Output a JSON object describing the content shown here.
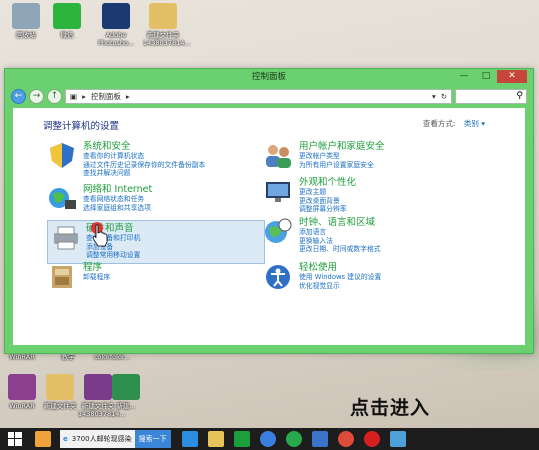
{
  "desktop": {
    "icons_top": [
      {
        "label": "回收站",
        "icon": "recycle-bin-icon",
        "color": "#8fa6b8"
      },
      {
        "label": "微信",
        "icon": "wechat-icon",
        "color": "#2db43c"
      },
      {
        "label": "Adobe Photosho...",
        "icon": "photoshop-icon",
        "color": "#1c3a72"
      },
      {
        "label": "新建文件夹 1438037814...",
        "icon": "folder-icon",
        "color": "#e3c068"
      }
    ],
    "icons_bottom": [
      {
        "label": "WinRAR",
        "icon": "winrar-icon",
        "color": "#8a3f8f"
      },
      {
        "label": "新建文件夹",
        "icon": "folder-icon",
        "color": "#e3c068"
      },
      {
        "label": "新建文件夹 1438037814...",
        "icon": "winrar-archive-icon",
        "color": "#7a3b8a"
      },
      {
        "label": "新建...",
        "icon": "excel-file-icon",
        "color": "#2f8f4e"
      }
    ],
    "partial_labels": [
      "WinRAR",
      "教学",
      "colorfolor..."
    ]
  },
  "window": {
    "title": "控制面板",
    "controls": {
      "minimize": "—",
      "maximize": "□",
      "close": "✕"
    },
    "address": "控制面板",
    "heading": "调整计算机的设置",
    "view_by_label": "查看方式:",
    "view_by_value": "类别 ▾"
  },
  "categories_left": [
    {
      "title": "系统和安全",
      "icon": "shield-icon",
      "links": [
        "查看你的计算机状态",
        "通过文件历史记录保存你的文件备份副本",
        "查找并解决问题"
      ]
    },
    {
      "title": "网络和 Internet",
      "icon": "network-globe-icon",
      "links": [
        "查看网络状态和任务",
        "选择家庭组和共享选项"
      ]
    },
    {
      "title": "硬件和声音",
      "icon": "printer-icon",
      "links": [
        "查看设备和打印机",
        "添加设备",
        "调整常用移动设置"
      ],
      "highlighted": true
    },
    {
      "title": "程序",
      "icon": "programs-icon",
      "links": [
        "卸载程序"
      ]
    }
  ],
  "categories_right": [
    {
      "title": "用户帐户和家庭安全",
      "icon": "users-icon",
      "links": [
        "更改帐户类型",
        "为所有用户设置家庭安全"
      ]
    },
    {
      "title": "外观和个性化",
      "icon": "appearance-icon",
      "links": [
        "更改主题",
        "更改桌面背景",
        "调整屏幕分辨率"
      ]
    },
    {
      "title": "时钟、语言和区域",
      "icon": "clock-globe-icon",
      "links": [
        "添加语言",
        "更换输入法",
        "更改日期、时间或数字格式"
      ]
    },
    {
      "title": "轻松使用",
      "icon": "ease-of-access-icon",
      "links": [
        "使用 Windows 建议的设置",
        "优化视觉显示"
      ]
    }
  ],
  "caption": "点击进入",
  "taskbar": {
    "search_text": "3700人邮轮现感染",
    "search_button": "搜索一下",
    "apps": [
      {
        "icon": "ie-icon",
        "color": "#2a8de0"
      },
      {
        "icon": "file-explorer-icon",
        "color": "#e7c35a"
      },
      {
        "icon": "store-icon",
        "color": "#1c9e3c"
      },
      {
        "icon": "baidu-cloud-icon",
        "color": "#3c7fe0"
      },
      {
        "icon": "browser-e-icon",
        "color": "#27a84a"
      },
      {
        "icon": "wps-icon",
        "color": "#3a74c9"
      },
      {
        "icon": "chrome-icon",
        "color": "#dd4b39"
      },
      {
        "icon": "recorder-icon",
        "color": "#d61f1f"
      },
      {
        "icon": "control-panel-icon",
        "color": "#4ea0d8"
      }
    ]
  }
}
